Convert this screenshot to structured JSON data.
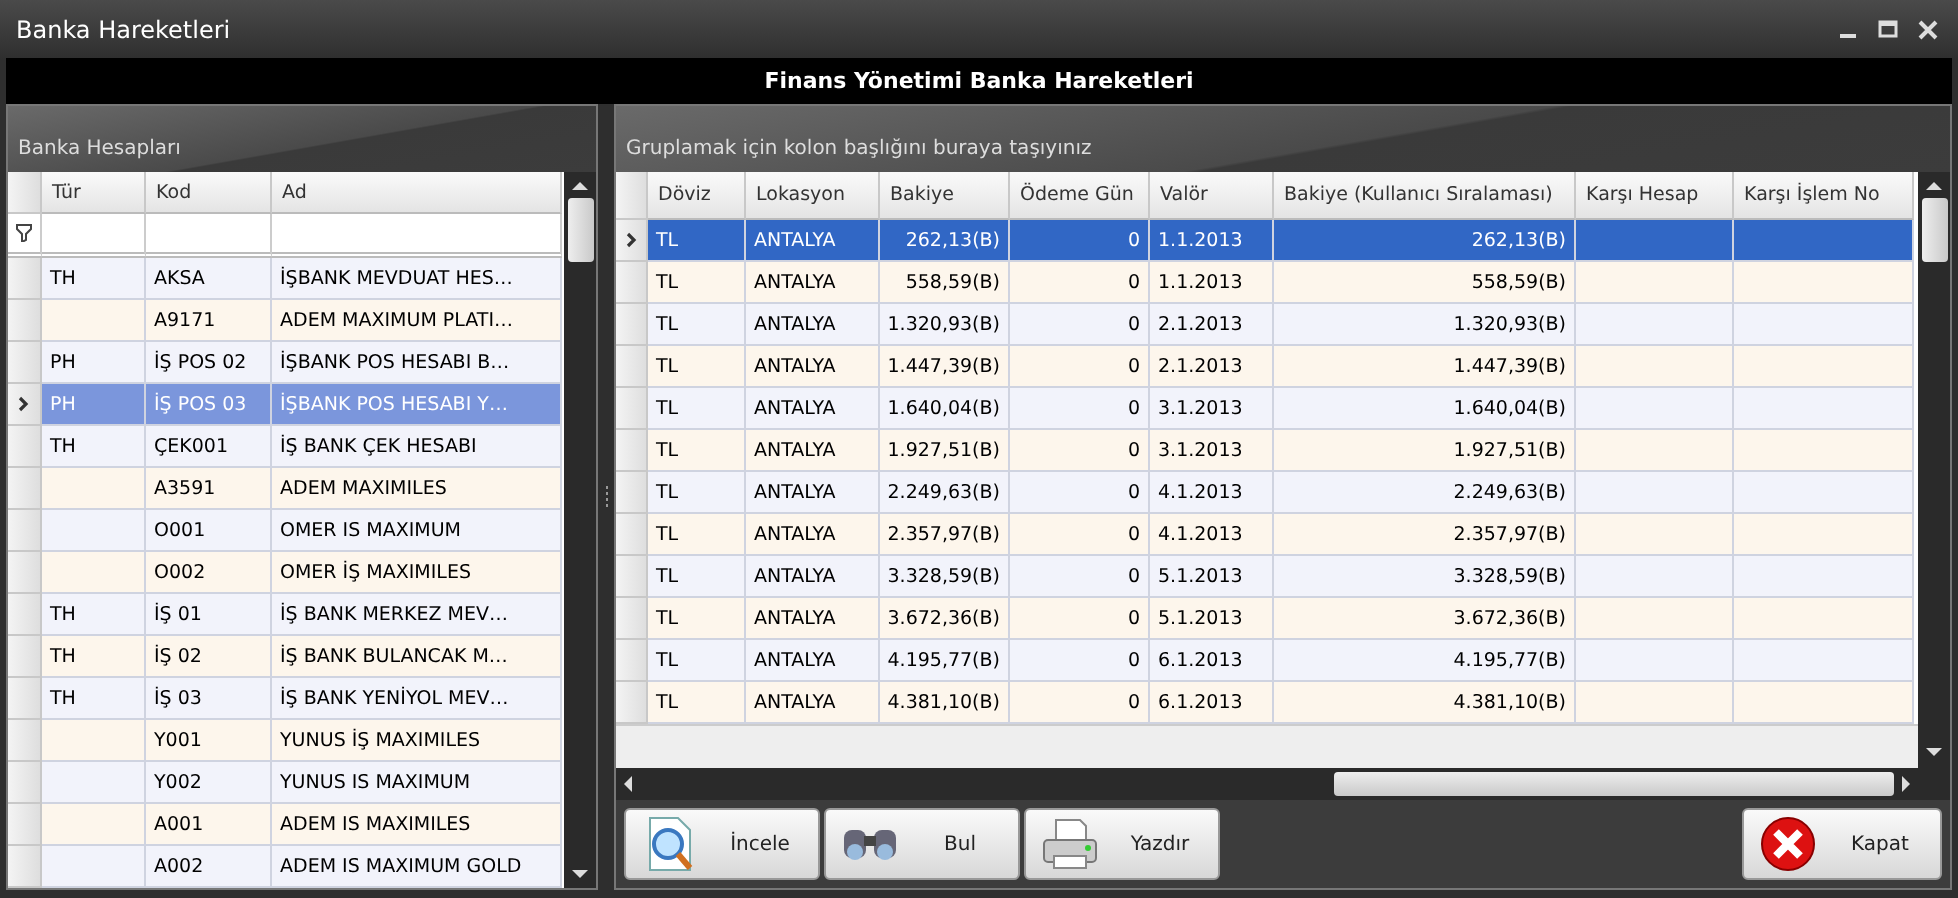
{
  "window": {
    "title": "Banka Hareketleri"
  },
  "header": {
    "title": "Finans Yönetimi Banka Hareketleri"
  },
  "accounts": {
    "group_title": "Banka Hesapları",
    "columns": [
      "Tür",
      "Kod",
      "Ad"
    ],
    "rows": [
      {
        "tur": "TH",
        "kod": "AKSA",
        "ad": "İŞBANK MEVDUAT HES…",
        "selected": false
      },
      {
        "tur": "",
        "kod": "A9171",
        "ad": "ADEM MAXIMUM PLATI…",
        "selected": false
      },
      {
        "tur": "PH",
        "kod": "İŞ POS 02",
        "ad": "İŞBANK POS HESABI B…",
        "selected": false
      },
      {
        "tur": "PH",
        "kod": "İŞ POS 03",
        "ad": "İŞBANK POS HESABI Y…",
        "selected": true
      },
      {
        "tur": "TH",
        "kod": "ÇEK001",
        "ad": "İŞ BANK ÇEK HESABI",
        "selected": false
      },
      {
        "tur": "",
        "kod": "A3591",
        "ad": "ADEM MAXIMILES",
        "selected": false
      },
      {
        "tur": "",
        "kod": "O001",
        "ad": "OMER IS MAXIMUM",
        "selected": false
      },
      {
        "tur": "",
        "kod": "O002",
        "ad": "OMER İŞ MAXIMILES",
        "selected": false
      },
      {
        "tur": "TH",
        "kod": "İŞ 01",
        "ad": "İŞ BANK MERKEZ MEV…",
        "selected": false
      },
      {
        "tur": "TH",
        "kod": "İŞ 02",
        "ad": "İŞ BANK BULANCAK M…",
        "selected": false
      },
      {
        "tur": "TH",
        "kod": "İŞ 03",
        "ad": "İŞ BANK YENİYOL MEV…",
        "selected": false
      },
      {
        "tur": "",
        "kod": "Y001",
        "ad": "YUNUS İŞ MAXIMILES",
        "selected": false
      },
      {
        "tur": "",
        "kod": "Y002",
        "ad": "YUNUS IS MAXIMUM",
        "selected": false
      },
      {
        "tur": "",
        "kod": "A001",
        "ad": "ADEM IS MAXIMILES",
        "selected": false
      },
      {
        "tur": "",
        "kod": "A002",
        "ad": "ADEM IS MAXIMUM GOLD",
        "selected": false
      }
    ]
  },
  "movements": {
    "group_hint": "Gruplamak için kolon başlığını buraya taşıyınız",
    "columns": [
      "Döviz",
      "Lokasyon",
      "Bakiye",
      "Ödeme Gün",
      "Valör",
      "Bakiye (Kullanıcı Sıralaması)",
      "Karşı Hesap",
      "Karşı İşlem No"
    ],
    "rows": [
      {
        "doviz": "TL",
        "lokasyon": "ANTALYA",
        "bakiye": "262,13(B)",
        "odeme_gun": "0",
        "valor": "1.1.2013",
        "bakiye_kullanici": "262,13(B)",
        "selected": true
      },
      {
        "doviz": "TL",
        "lokasyon": "ANTALYA",
        "bakiye": "558,59(B)",
        "odeme_gun": "0",
        "valor": "1.1.2013",
        "bakiye_kullanici": "558,59(B)",
        "selected": false
      },
      {
        "doviz": "TL",
        "lokasyon": "ANTALYA",
        "bakiye": "1.320,93(B)",
        "odeme_gun": "0",
        "valor": "2.1.2013",
        "bakiye_kullanici": "1.320,93(B)",
        "selected": false
      },
      {
        "doviz": "TL",
        "lokasyon": "ANTALYA",
        "bakiye": "1.447,39(B)",
        "odeme_gun": "0",
        "valor": "2.1.2013",
        "bakiye_kullanici": "1.447,39(B)",
        "selected": false
      },
      {
        "doviz": "TL",
        "lokasyon": "ANTALYA",
        "bakiye": "1.640,04(B)",
        "odeme_gun": "0",
        "valor": "3.1.2013",
        "bakiye_kullanici": "1.640,04(B)",
        "selected": false
      },
      {
        "doviz": "TL",
        "lokasyon": "ANTALYA",
        "bakiye": "1.927,51(B)",
        "odeme_gun": "0",
        "valor": "3.1.2013",
        "bakiye_kullanici": "1.927,51(B)",
        "selected": false
      },
      {
        "doviz": "TL",
        "lokasyon": "ANTALYA",
        "bakiye": "2.249,63(B)",
        "odeme_gun": "0",
        "valor": "4.1.2013",
        "bakiye_kullanici": "2.249,63(B)",
        "selected": false
      },
      {
        "doviz": "TL",
        "lokasyon": "ANTALYA",
        "bakiye": "2.357,97(B)",
        "odeme_gun": "0",
        "valor": "4.1.2013",
        "bakiye_kullanici": "2.357,97(B)",
        "selected": false
      },
      {
        "doviz": "TL",
        "lokasyon": "ANTALYA",
        "bakiye": "3.328,59(B)",
        "odeme_gun": "0",
        "valor": "5.1.2013",
        "bakiye_kullanici": "3.328,59(B)",
        "selected": false
      },
      {
        "doviz": "TL",
        "lokasyon": "ANTALYA",
        "bakiye": "3.672,36(B)",
        "odeme_gun": "0",
        "valor": "5.1.2013",
        "bakiye_kullanici": "3.672,36(B)",
        "selected": false
      },
      {
        "doviz": "TL",
        "lokasyon": "ANTALYA",
        "bakiye": "4.195,77(B)",
        "odeme_gun": "0",
        "valor": "6.1.2013",
        "bakiye_kullanici": "4.195,77(B)",
        "selected": false
      },
      {
        "doviz": "TL",
        "lokasyon": "ANTALYA",
        "bakiye": "4.381,10(B)",
        "odeme_gun": "0",
        "valor": "6.1.2013",
        "bakiye_kullanici": "4.381,10(B)",
        "selected": false
      }
    ]
  },
  "buttons": [
    {
      "kind": "inspect",
      "label": "İncele"
    },
    {
      "kind": "find",
      "label": "Bul"
    },
    {
      "kind": "print",
      "label": "Yazdır"
    },
    {
      "kind": "close",
      "label": "Kapat"
    }
  ]
}
